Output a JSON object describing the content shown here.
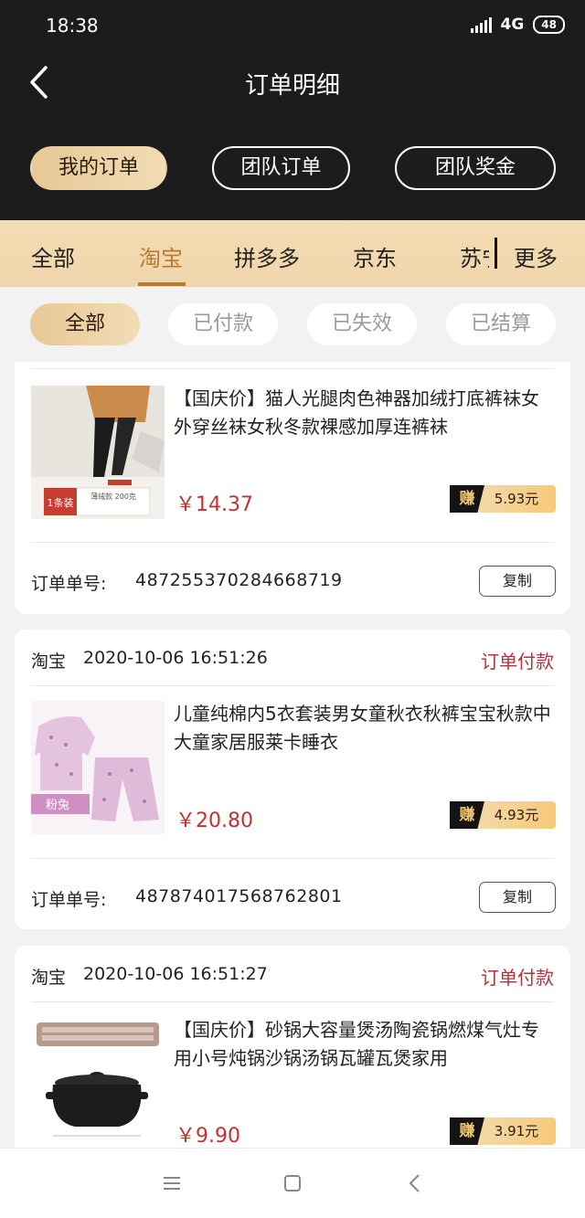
{
  "status_bar": {
    "time": "18:38",
    "network": "4G",
    "battery": "48"
  },
  "header": {
    "title": "订单明细"
  },
  "segments": [
    {
      "label": "我的订单"
    },
    {
      "label": "团队订单"
    },
    {
      "label": "团队奖金"
    }
  ],
  "platform_tabs": {
    "items": [
      "全部",
      "淘宝",
      "拼多多",
      "京东",
      "苏宁"
    ],
    "more": "更多",
    "active_index": 1
  },
  "status_filters": {
    "items": [
      "全部",
      "已付款",
      "已失效",
      "已结算"
    ],
    "active_index": 0
  },
  "orders": [
    {
      "title": "【国庆价】猫人光腿肉色神器加绒打底裤袜女外穿丝袜女秋冬款裸感加厚连裤袜",
      "price": "￥14.37",
      "earn_label": "赚",
      "earn_value": "5.93元",
      "order_no_label": "订单单号:",
      "order_no": "487255370284668719",
      "copy_label": "复制",
      "thumb_badge": "1条装",
      "thumb_text": "薄绒款 200克"
    },
    {
      "platform": "淘宝",
      "time": "2020-10-06 16:51:26",
      "status": "订单付款",
      "title": "儿童纯棉内5衣套装男女童秋衣秋裤宝宝秋款中大童家居服莱卡睡衣",
      "price": "￥20.80",
      "earn_label": "赚",
      "earn_value": "4.93元",
      "order_no_label": "订单单号:",
      "order_no": "487874017568762801",
      "copy_label": "复制",
      "thumb_tag": "粉兔"
    },
    {
      "platform": "淘宝",
      "time": "2020-10-06 16:51:27",
      "status": "订单付款",
      "title": "【国庆价】砂锅大容量煲汤陶瓷锅燃煤气灶专用小号炖锅沙锅汤锅瓦罐瓦煲家用",
      "price": "￥9.90",
      "earn_label": "赚",
      "earn_value": "3.91元"
    }
  ],
  "colors": {
    "header_bg": "#1d1b1b",
    "gold": "#e7c896",
    "accent_tab": "#b77a2d",
    "price_red": "#c0332f"
  },
  "nav_icons": [
    "menu-icon",
    "home-square-icon",
    "back-triangle-icon"
  ]
}
